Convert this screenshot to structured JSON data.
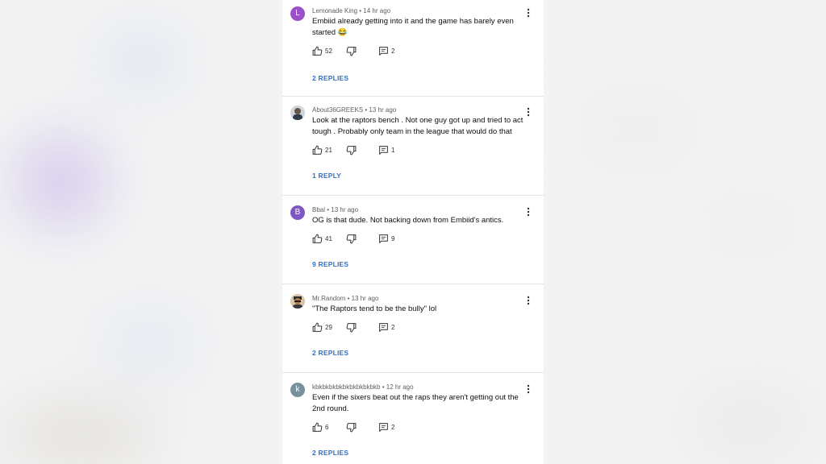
{
  "comments": [
    {
      "author": "Lemonade King",
      "time": "14 hr ago",
      "text": "Embiid already getting into it and the game has barely even started 😂",
      "likes": "52",
      "reply_count": "2",
      "replies_label": "2 REPLIES",
      "avatar_letter": "L",
      "avatar_color": "#9b4fc9"
    },
    {
      "author": "About36GREEKS",
      "time": "13 hr ago",
      "text": "Look at the raptors bench . Not one guy got up and tried to act tough . Probably only team in the league that would do that",
      "likes": "21",
      "reply_count": "1",
      "replies_label": "1 REPLY",
      "avatar_letter": "",
      "avatar_color": "#7d6a5c"
    },
    {
      "author": "Bbal",
      "time": "13 hr ago",
      "text": "OG is that dude. Not backing down from Embiid's antics.",
      "likes": "41",
      "reply_count": "9",
      "replies_label": "9 REPLIES",
      "avatar_letter": "B",
      "avatar_color": "#7e57c2"
    },
    {
      "author": "Mr.Random",
      "time": "13 hr ago",
      "text": "\"The Raptors tend to be the bully\" lol",
      "likes": "29",
      "reply_count": "2",
      "replies_label": "2 REPLIES",
      "avatar_letter": "",
      "avatar_color": "#8a6d4a"
    },
    {
      "author": "kbkbkbkbkbkbkbkbkbkb",
      "time": "12 hr ago",
      "text": "Even if the sixers beat out the raps they aren't getting out the 2nd round.",
      "likes": "6",
      "reply_count": "2",
      "replies_label": "2 REPLIES",
      "avatar_letter": "k",
      "avatar_color": "#78909c"
    }
  ],
  "meta_separator": " • ",
  "accent_color": "#3170c6",
  "icons": {
    "like": "thumb-up-icon",
    "dislike": "thumb-down-icon",
    "reply": "comment-icon",
    "more": "more-vert-icon"
  }
}
